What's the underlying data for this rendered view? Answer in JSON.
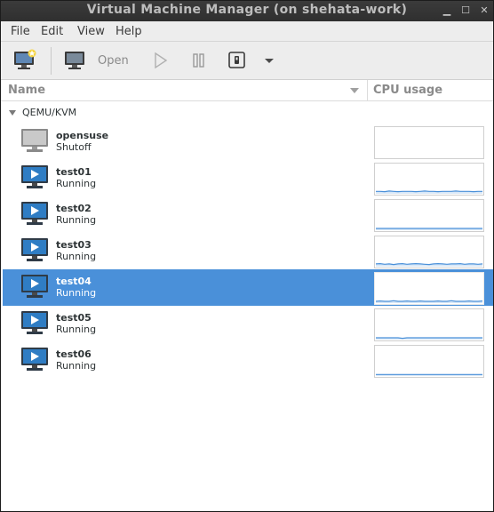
{
  "window": {
    "title": "Virtual Machine Manager (on shehata-work)",
    "controls": {
      "minimize": "▁",
      "maximize": "☐",
      "close": "✕"
    }
  },
  "menubar": {
    "items": [
      "File",
      "Edit",
      "View",
      "Help"
    ]
  },
  "toolbar": {
    "new_vm_icon": "new-vm-monitor-icon",
    "open_label": "Open",
    "run_icon": "play-icon",
    "pause_icon": "pause-icon",
    "shutdown_icon": "shutdown-icon",
    "shutdown_menu_icon": "chevron-down-icon"
  },
  "columns": {
    "name": "Name",
    "cpu": "CPU usage"
  },
  "connection": {
    "label": "QEMU/KVM",
    "vms": [
      {
        "name": "opensuse",
        "status": "Shutoff",
        "running": false,
        "selected": false,
        "cpu_samples": []
      },
      {
        "name": "test01",
        "status": "Running",
        "running": true,
        "selected": false,
        "cpu_samples": [
          0.08,
          0.08,
          0.07,
          0.09,
          0.08,
          0.07,
          0.08,
          0.08,
          0.08,
          0.07,
          0.08,
          0.09,
          0.08,
          0.08,
          0.07,
          0.08,
          0.08,
          0.08,
          0.09,
          0.08,
          0.08,
          0.08,
          0.07,
          0.08,
          0.08
        ]
      },
      {
        "name": "test02",
        "status": "Running",
        "running": true,
        "selected": false,
        "cpu_samples": [
          0.06,
          0.06,
          0.06,
          0.06,
          0.06,
          0.06,
          0.06,
          0.06,
          0.06,
          0.06,
          0.06,
          0.06,
          0.06,
          0.06,
          0.06,
          0.06,
          0.06,
          0.06,
          0.06,
          0.06,
          0.06,
          0.06,
          0.06,
          0.06,
          0.06
        ]
      },
      {
        "name": "test03",
        "status": "Running",
        "running": true,
        "selected": false,
        "cpu_samples": [
          0.09,
          0.1,
          0.08,
          0.09,
          0.07,
          0.09,
          0.1,
          0.08,
          0.09,
          0.1,
          0.09,
          0.08,
          0.07,
          0.09,
          0.1,
          0.09,
          0.08,
          0.09,
          0.09,
          0.1,
          0.08,
          0.09,
          0.09,
          0.08,
          0.09
        ]
      },
      {
        "name": "test04",
        "status": "Running",
        "running": true,
        "selected": true,
        "cpu_samples": [
          0.06,
          0.07,
          0.06,
          0.06,
          0.08,
          0.06,
          0.06,
          0.07,
          0.06,
          0.06,
          0.07,
          0.06,
          0.06,
          0.06,
          0.07,
          0.06,
          0.06,
          0.08,
          0.06,
          0.06,
          0.06,
          0.07,
          0.06,
          0.06,
          0.07
        ]
      },
      {
        "name": "test05",
        "status": "Running",
        "running": true,
        "selected": false,
        "cpu_samples": [
          0.06,
          0.06,
          0.06,
          0.06,
          0.06,
          0.06,
          0.04,
          0.06,
          0.06,
          0.06,
          0.06,
          0.06,
          0.06,
          0.06,
          0.06,
          0.06,
          0.06,
          0.06,
          0.06,
          0.06,
          0.06,
          0.06,
          0.06,
          0.06,
          0.06
        ]
      },
      {
        "name": "test06",
        "status": "Running",
        "running": true,
        "selected": false,
        "cpu_samples": [
          0.05,
          0.05,
          0.05,
          0.05,
          0.05,
          0.05,
          0.05,
          0.05,
          0.05,
          0.05,
          0.05,
          0.05,
          0.05,
          0.05,
          0.05,
          0.05,
          0.05,
          0.05,
          0.05,
          0.05,
          0.05,
          0.05,
          0.05,
          0.05,
          0.05
        ]
      }
    ]
  },
  "colors": {
    "selection": "#4a90d9",
    "graph_line": "#4a90d9",
    "graph_fill": "#d9e8f7"
  }
}
